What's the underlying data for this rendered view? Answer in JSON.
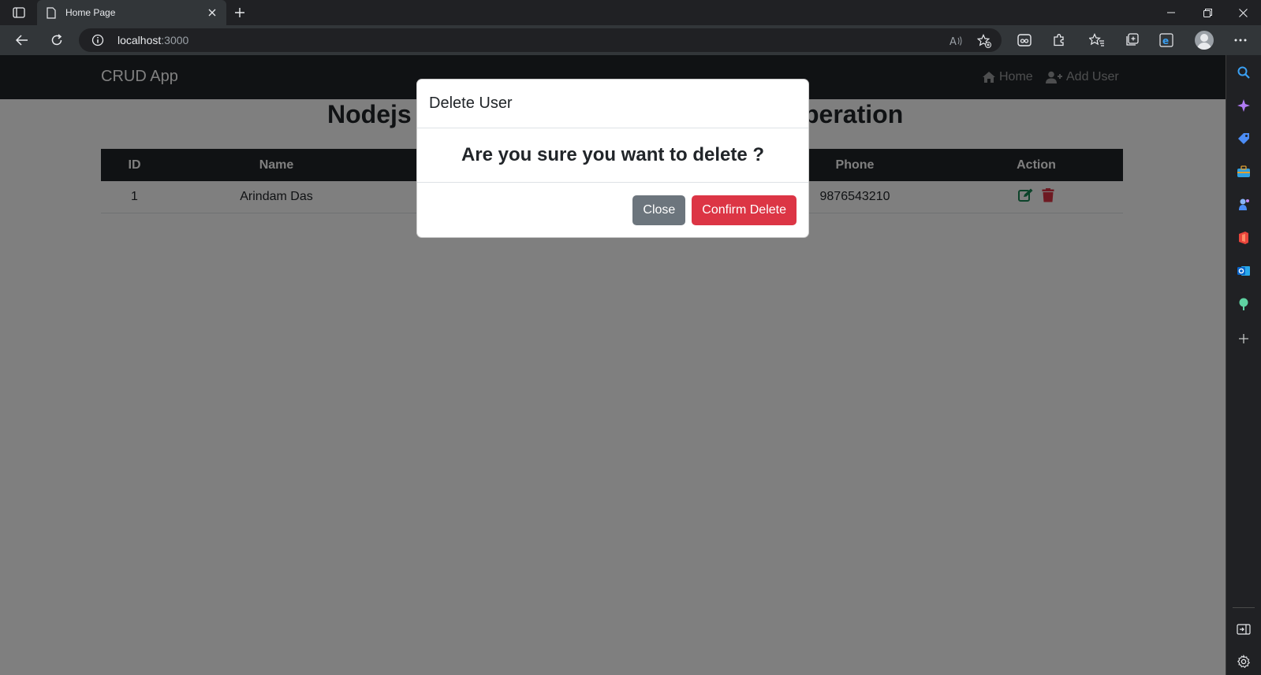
{
  "browser": {
    "tab_title": "Home Page",
    "url_host": "localhost",
    "url_port": ":3000"
  },
  "app": {
    "brand": "CRUD App",
    "nav_home": "Home",
    "nav_add_user": "Add User",
    "heading_left": "Nodejs",
    "heading_right": "peration"
  },
  "table": {
    "headers": [
      "ID",
      "Name",
      "Phone",
      "Action"
    ],
    "rows": [
      {
        "id": "1",
        "name": "Arindam Das",
        "phone": "9876543210"
      }
    ]
  },
  "modal": {
    "title": "Delete User",
    "question": "Are you sure you want to delete ?",
    "close_label": "Close",
    "confirm_label": "Confirm Delete"
  },
  "colors": {
    "edit_icon": "#198754",
    "delete_icon": "#dc3545",
    "confirm_button": "#dc3545",
    "close_button": "#6c757d"
  }
}
